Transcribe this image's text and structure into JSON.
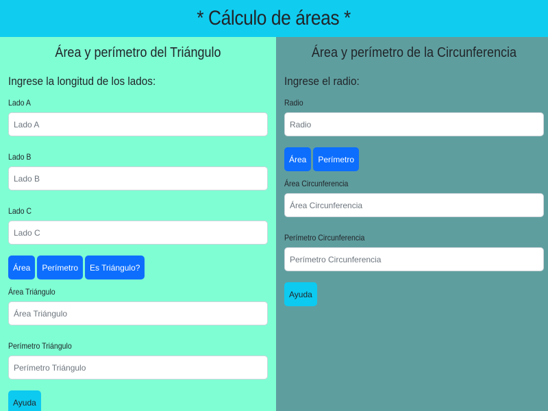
{
  "header": {
    "title": "* Cálculo de áreas *"
  },
  "triangle": {
    "title": "Área y perímetro del Triángulo",
    "subtitle": "Ingrese la longitud de los lados:",
    "inputs": [
      {
        "label": "Lado A",
        "placeholder": "Lado A"
      },
      {
        "label": "Lado B",
        "placeholder": "Lado B"
      },
      {
        "label": "Lado C",
        "placeholder": "Lado C"
      }
    ],
    "buttons": {
      "area": "Área",
      "perimeter": "Perímetro",
      "is_triangle": "Es Triángulo?"
    },
    "outputs": [
      {
        "label": "Área Triángulo",
        "placeholder": "Área Triángulo"
      },
      {
        "label": "Perímetro Triángulo",
        "placeholder": "Perímetro Triángulo"
      }
    ],
    "help": "Ayuda"
  },
  "circle": {
    "title": "Área y perímetro de la Circunferencia",
    "subtitle": "Ingrese el radio:",
    "input": {
      "label": "Radio",
      "placeholder": "Radio"
    },
    "buttons": {
      "area": "Área",
      "perimeter": "Perímetro"
    },
    "outputs": [
      {
        "label": "Área Circunferencia",
        "placeholder": "Área Circunferencia"
      },
      {
        "label": "Perímetro Circunferencia",
        "placeholder": "Perímetro Circunferencia"
      }
    ],
    "help": "Ayuda"
  },
  "colors": {
    "header_bg": "#10cdf0",
    "left_bg": "#7ffed3",
    "right_bg": "#5f9e9f",
    "primary_button": "#0d6efd",
    "info_button": "#0dcaf0"
  }
}
